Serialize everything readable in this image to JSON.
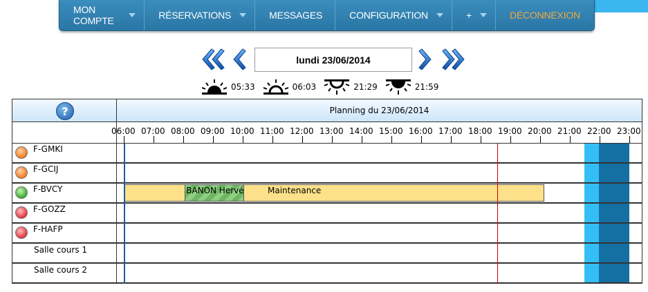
{
  "nav": {
    "items": [
      {
        "label": "MON COMPTE",
        "has_menu": true
      },
      {
        "label": "RÉSERVATIONS",
        "has_menu": true
      },
      {
        "label": "MESSAGES",
        "has_menu": false
      },
      {
        "label": "CONFIGURATION",
        "has_menu": true
      },
      {
        "label": "+",
        "has_menu": true
      }
    ],
    "logout": "DÉCONNEXION"
  },
  "date": {
    "current": "lundi 23/06/2014"
  },
  "sun_times": [
    "05:33",
    "06:03",
    "21:29",
    "21:59"
  ],
  "planning": {
    "title": "Planning du 23/06/2014",
    "help_icon": "?",
    "hours": [
      "06:00",
      "07:00",
      "08:00",
      "09:00",
      "10:00",
      "11:00",
      "12:00",
      "13:00",
      "14:00",
      "15:00",
      "16:00",
      "17:00",
      "18:00",
      "19:00",
      "20:00",
      "21:00",
      "22:00",
      "23:00"
    ],
    "resources": [
      {
        "name": "F-GMKI",
        "status": "orange"
      },
      {
        "name": "F-GCIJ",
        "status": "orange"
      },
      {
        "name": "F-BVCY",
        "status": "green"
      },
      {
        "name": "F-GOZZ",
        "status": "red"
      },
      {
        "name": "F-HAFP",
        "status": "red"
      },
      {
        "name": "Salle cours 1",
        "status": ""
      },
      {
        "name": "Salle cours 2",
        "status": ""
      }
    ],
    "bookings": [
      {
        "label": "Maintenance",
        "row": 2,
        "start": 6.0,
        "end": 20.15
      },
      {
        "label": "BANON Hervé",
        "row": 2,
        "start": 8.05,
        "end": 10.05
      }
    ],
    "current_time": 18.55,
    "colors": {
      "civil_twilight": "#33bff5",
      "night": "#1470a3",
      "now_line": "#cc0000",
      "booking": "#fde18a"
    }
  }
}
